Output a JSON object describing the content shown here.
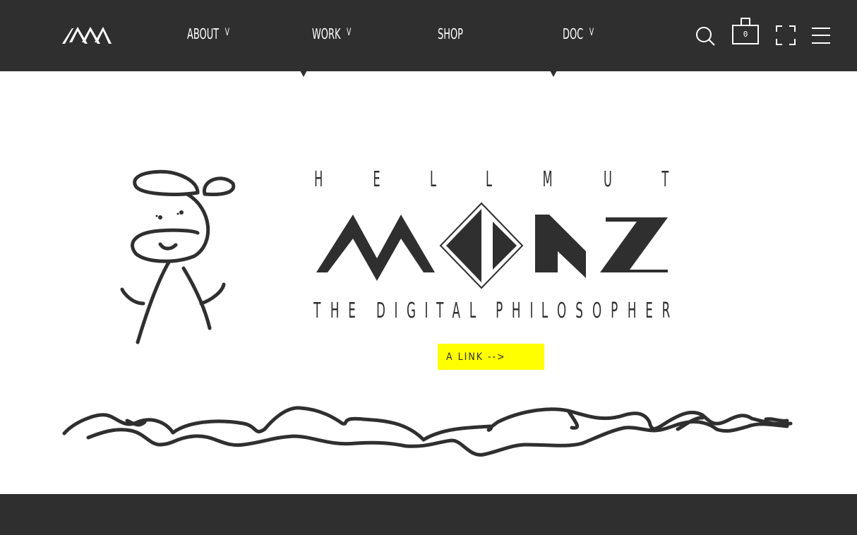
{
  "header": {
    "logo_name": "mm-logo",
    "nav": [
      {
        "label": "ABOUT",
        "has_dropdown": true
      },
      {
        "label": "WORK",
        "has_dropdown": true
      },
      {
        "label": "SHOP",
        "has_dropdown": false
      },
      {
        "label": "DOC",
        "has_dropdown": true
      }
    ],
    "chevron_glyph": "v",
    "cart_count": "0",
    "icons": [
      "search-icon",
      "cart-icon",
      "fullscreen-icon",
      "menu-icon"
    ]
  },
  "hero": {
    "top_letters": [
      "H",
      "E",
      "L",
      "L",
      "M",
      "U",
      "T"
    ],
    "wordmark": "MONZ",
    "tagline_letters": [
      "T",
      "H",
      "E",
      " ",
      "D",
      "I",
      "G",
      "I",
      "T",
      "A",
      "L",
      " ",
      "P",
      "H",
      "I",
      "L",
      "O",
      "S",
      "O",
      "P",
      "H",
      "E",
      "R"
    ],
    "cta_label": "A LINK -->"
  },
  "colors": {
    "dark": "#2f2f2f",
    "accent": "#ffff00",
    "background": "#ffffff"
  }
}
